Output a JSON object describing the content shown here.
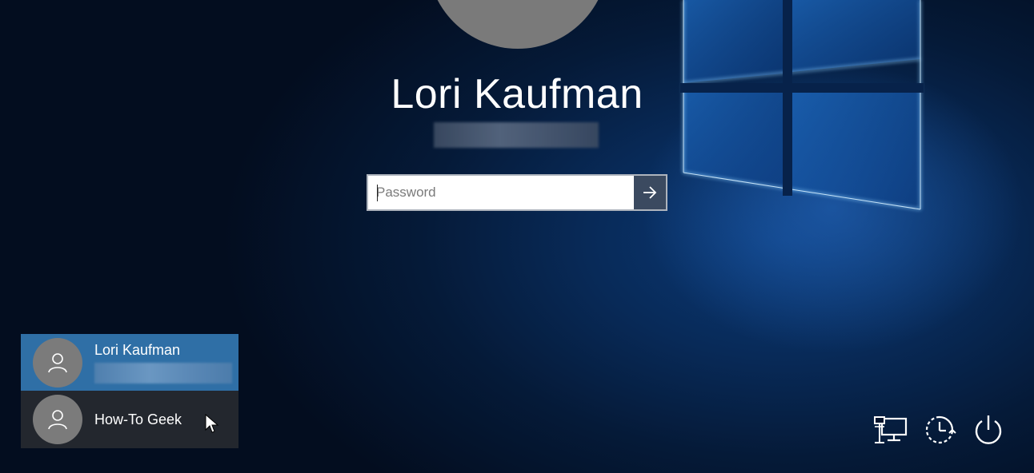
{
  "user": {
    "name": "Lori Kaufman"
  },
  "password": {
    "placeholder": "Password"
  },
  "user_list": [
    {
      "name": "Lori Kaufman",
      "selected": true
    },
    {
      "name": "How-To Geek",
      "selected": false
    }
  ],
  "icons": {
    "submit": "arrow-right-icon",
    "avatar": "person-icon",
    "network": "network-icon",
    "ease_of_access": "ease-of-access-icon",
    "power": "power-icon"
  },
  "colors": {
    "selected_tile": "#2f6fa6",
    "other_tile": "#23272e",
    "submit_button": "#3b4a60",
    "avatar": "#7b7b7b"
  }
}
